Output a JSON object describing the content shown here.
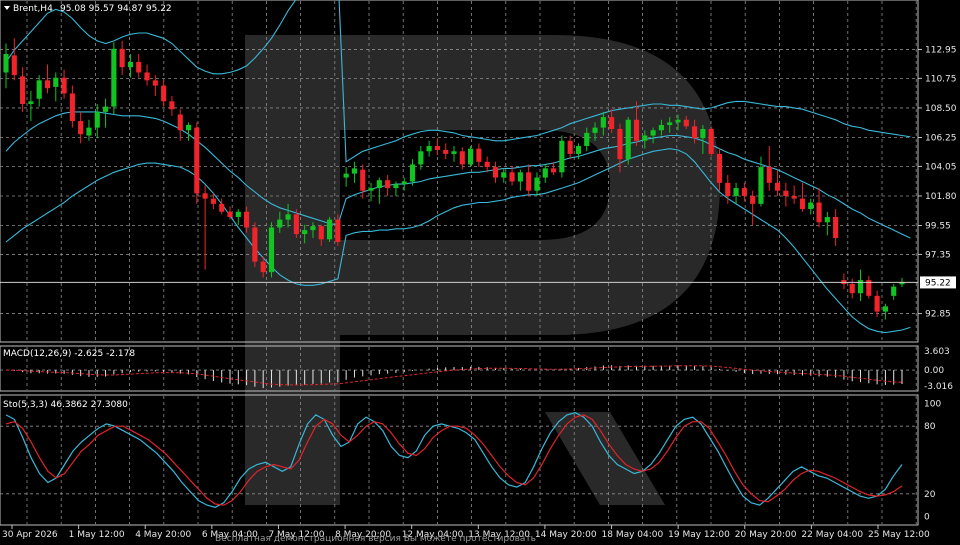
{
  "chart_data": {
    "type": "candlestick",
    "header": {
      "symbol": "Brent,H4",
      "ohlc": "95.08 95.57 94.87 95.22"
    },
    "price_axis": {
      "range": [
        91.6,
        115.8
      ],
      "ticks": [
        "112.95",
        "110.75",
        "108.50",
        "106.25",
        "104.05",
        "101.80",
        "99.55",
        "97.35",
        "95.22",
        "92.85"
      ],
      "tick_values": [
        112.95,
        110.75,
        108.5,
        106.25,
        104.05,
        101.8,
        99.55,
        97.35,
        92.85
      ],
      "current_price": 95.22
    },
    "time_axis": {
      "labels": [
        "30 Apr 2026",
        "1 May 12:00",
        "4 May 20:00",
        "6 May 04:00",
        "7 May 12:00",
        "8 May 20:00",
        "12 May 04:00",
        "13 May 12:00",
        "14 May 20:00",
        "18 May 04:00",
        "19 May 12:00",
        "20 May 20:00",
        "22 May 04:00",
        "25 May 12:00"
      ]
    },
    "candles": [
      {
        "o": 111.2,
        "h": 113.4,
        "l": 110.0,
        "c": 112.6
      },
      {
        "o": 112.5,
        "h": 113.8,
        "l": 110.6,
        "c": 111.0
      },
      {
        "o": 110.9,
        "h": 111.6,
        "l": 108.2,
        "c": 108.8
      },
      {
        "o": 108.8,
        "h": 109.8,
        "l": 107.5,
        "c": 109.0
      },
      {
        "o": 109.2,
        "h": 111.0,
        "l": 108.6,
        "c": 110.6
      },
      {
        "o": 110.6,
        "h": 111.8,
        "l": 109.6,
        "c": 110.0
      },
      {
        "o": 110.1,
        "h": 111.2,
        "l": 109.0,
        "c": 110.8
      },
      {
        "o": 110.8,
        "h": 111.4,
        "l": 109.2,
        "c": 109.6
      },
      {
        "o": 109.6,
        "h": 110.2,
        "l": 107.0,
        "c": 107.5
      },
      {
        "o": 107.5,
        "h": 108.2,
        "l": 105.8,
        "c": 106.5
      },
      {
        "o": 106.4,
        "h": 107.6,
        "l": 106.0,
        "c": 107.0
      },
      {
        "o": 107.0,
        "h": 108.8,
        "l": 106.2,
        "c": 108.2
      },
      {
        "o": 108.2,
        "h": 109.2,
        "l": 107.0,
        "c": 108.6
      },
      {
        "o": 108.6,
        "h": 113.5,
        "l": 108.0,
        "c": 113.0
      },
      {
        "o": 113.0,
        "h": 113.6,
        "l": 111.0,
        "c": 111.6
      },
      {
        "o": 111.6,
        "h": 112.6,
        "l": 110.8,
        "c": 112.0
      },
      {
        "o": 112.0,
        "h": 112.6,
        "l": 110.8,
        "c": 111.2
      },
      {
        "o": 111.2,
        "h": 111.8,
        "l": 110.2,
        "c": 110.6
      },
      {
        "o": 110.6,
        "h": 111.0,
        "l": 109.4,
        "c": 110.2
      },
      {
        "o": 110.2,
        "h": 110.6,
        "l": 108.6,
        "c": 109.0
      },
      {
        "o": 109.0,
        "h": 109.4,
        "l": 107.9,
        "c": 108.4
      },
      {
        "o": 108.0,
        "h": 108.4,
        "l": 106.0,
        "c": 106.8
      },
      {
        "o": 106.8,
        "h": 107.4,
        "l": 106.0,
        "c": 107.2
      },
      {
        "o": 107.0,
        "h": 107.4,
        "l": 101.2,
        "c": 102.0
      },
      {
        "o": 102.0,
        "h": 102.6,
        "l": 96.2,
        "c": 101.6
      },
      {
        "o": 101.6,
        "h": 102.0,
        "l": 100.8,
        "c": 101.2
      },
      {
        "o": 101.2,
        "h": 101.6,
        "l": 100.4,
        "c": 100.6
      },
      {
        "o": 100.6,
        "h": 101.0,
        "l": 100.0,
        "c": 100.2
      },
      {
        "o": 100.2,
        "h": 100.8,
        "l": 99.6,
        "c": 100.6
      },
      {
        "o": 100.6,
        "h": 101.0,
        "l": 99.0,
        "c": 99.4
      },
      {
        "o": 99.4,
        "h": 99.8,
        "l": 96.4,
        "c": 96.8
      },
      {
        "o": 96.8,
        "h": 97.2,
        "l": 95.6,
        "c": 96.0
      },
      {
        "o": 96.0,
        "h": 99.8,
        "l": 95.6,
        "c": 99.4
      },
      {
        "o": 99.4,
        "h": 100.6,
        "l": 99.0,
        "c": 100.0
      },
      {
        "o": 100.0,
        "h": 101.2,
        "l": 99.4,
        "c": 100.4
      },
      {
        "o": 100.4,
        "h": 100.8,
        "l": 98.6,
        "c": 98.9
      },
      {
        "o": 98.9,
        "h": 99.6,
        "l": 98.2,
        "c": 99.2
      },
      {
        "o": 99.2,
        "h": 99.8,
        "l": 98.6,
        "c": 99.5
      },
      {
        "o": 99.5,
        "h": 99.6,
        "l": 98.0,
        "c": 98.5
      },
      {
        "o": 98.5,
        "h": 100.2,
        "l": 98.3,
        "c": 100.0
      },
      {
        "o": 100.0,
        "h": 100.4,
        "l": 98.0,
        "c": 98.3
      },
      {
        "o": 103.2,
        "h": 104.0,
        "l": 102.5,
        "c": 103.5
      },
      {
        "o": 103.5,
        "h": 104.4,
        "l": 102.8,
        "c": 103.9
      },
      {
        "o": 103.8,
        "h": 104.2,
        "l": 101.6,
        "c": 102.2
      },
      {
        "o": 102.2,
        "h": 102.8,
        "l": 101.4,
        "c": 102.4
      },
      {
        "o": 102.4,
        "h": 103.2,
        "l": 101.2,
        "c": 103.0
      },
      {
        "o": 103.0,
        "h": 103.4,
        "l": 101.8,
        "c": 102.4
      },
      {
        "o": 102.4,
        "h": 102.9,
        "l": 101.8,
        "c": 102.7
      },
      {
        "o": 102.7,
        "h": 103.2,
        "l": 102.2,
        "c": 102.9
      },
      {
        "o": 102.9,
        "h": 104.6,
        "l": 102.6,
        "c": 104.2
      },
      {
        "o": 104.2,
        "h": 105.6,
        "l": 103.8,
        "c": 105.2
      },
      {
        "o": 105.2,
        "h": 106.0,
        "l": 104.8,
        "c": 105.6
      },
      {
        "o": 105.6,
        "h": 106.2,
        "l": 104.9,
        "c": 105.3
      },
      {
        "o": 105.3,
        "h": 105.8,
        "l": 104.6,
        "c": 105.0
      },
      {
        "o": 105.0,
        "h": 105.6,
        "l": 104.4,
        "c": 105.2
      },
      {
        "o": 105.2,
        "h": 105.5,
        "l": 103.8,
        "c": 104.2
      },
      {
        "o": 104.2,
        "h": 105.6,
        "l": 104.0,
        "c": 105.4
      },
      {
        "o": 105.4,
        "h": 105.8,
        "l": 104.0,
        "c": 104.4
      },
      {
        "o": 104.4,
        "h": 104.8,
        "l": 103.6,
        "c": 104.0
      },
      {
        "o": 104.0,
        "h": 104.4,
        "l": 102.8,
        "c": 103.2
      },
      {
        "o": 103.2,
        "h": 103.9,
        "l": 102.8,
        "c": 103.6
      },
      {
        "o": 103.6,
        "h": 104.1,
        "l": 102.6,
        "c": 102.9
      },
      {
        "o": 102.9,
        "h": 103.8,
        "l": 102.2,
        "c": 103.6
      },
      {
        "o": 103.6,
        "h": 104.2,
        "l": 101.8,
        "c": 102.2
      },
      {
        "o": 102.2,
        "h": 103.6,
        "l": 101.8,
        "c": 103.2
      },
      {
        "o": 103.2,
        "h": 104.2,
        "l": 102.8,
        "c": 103.9
      },
      {
        "o": 103.9,
        "h": 104.4,
        "l": 103.4,
        "c": 103.6
      },
      {
        "o": 103.6,
        "h": 106.4,
        "l": 103.2,
        "c": 106.0
      },
      {
        "o": 106.0,
        "h": 106.4,
        "l": 104.6,
        "c": 105.0
      },
      {
        "o": 105.0,
        "h": 105.8,
        "l": 104.6,
        "c": 105.6
      },
      {
        "o": 105.6,
        "h": 107.0,
        "l": 105.2,
        "c": 106.6
      },
      {
        "o": 106.6,
        "h": 107.4,
        "l": 106.0,
        "c": 107.0
      },
      {
        "o": 107.0,
        "h": 108.2,
        "l": 106.4,
        "c": 107.8
      },
      {
        "o": 107.8,
        "h": 108.4,
        "l": 106.6,
        "c": 106.9
      },
      {
        "o": 106.9,
        "h": 107.3,
        "l": 103.6,
        "c": 104.6
      },
      {
        "o": 104.6,
        "h": 107.8,
        "l": 104.2,
        "c": 107.6
      },
      {
        "o": 107.6,
        "h": 109.0,
        "l": 105.6,
        "c": 106.0
      },
      {
        "o": 106.0,
        "h": 106.8,
        "l": 105.4,
        "c": 106.4
      },
      {
        "o": 106.4,
        "h": 107.0,
        "l": 105.8,
        "c": 106.8
      },
      {
        "o": 106.8,
        "h": 107.6,
        "l": 106.4,
        "c": 107.2
      },
      {
        "o": 107.2,
        "h": 107.8,
        "l": 106.6,
        "c": 107.4
      },
      {
        "o": 107.4,
        "h": 108.0,
        "l": 106.8,
        "c": 107.6
      },
      {
        "o": 107.6,
        "h": 107.9,
        "l": 106.9,
        "c": 107.1
      },
      {
        "o": 107.1,
        "h": 107.6,
        "l": 105.8,
        "c": 106.2
      },
      {
        "o": 106.2,
        "h": 107.2,
        "l": 105.0,
        "c": 106.9
      },
      {
        "o": 106.9,
        "h": 107.0,
        "l": 104.8,
        "c": 105.0
      },
      {
        "o": 105.0,
        "h": 105.4,
        "l": 102.2,
        "c": 102.8
      },
      {
        "o": 102.8,
        "h": 103.4,
        "l": 101.2,
        "c": 101.8
      },
      {
        "o": 101.8,
        "h": 102.8,
        "l": 101.2,
        "c": 102.4
      },
      {
        "o": 102.4,
        "h": 102.8,
        "l": 101.4,
        "c": 101.8
      },
      {
        "o": 101.8,
        "h": 102.2,
        "l": 99.6,
        "c": 101.2
      },
      {
        "o": 101.2,
        "h": 104.8,
        "l": 101.0,
        "c": 104.0
      },
      {
        "o": 104.0,
        "h": 105.6,
        "l": 102.2,
        "c": 102.8
      },
      {
        "o": 102.8,
        "h": 103.8,
        "l": 101.8,
        "c": 102.2
      },
      {
        "o": 102.2,
        "h": 102.8,
        "l": 101.0,
        "c": 101.8
      },
      {
        "o": 101.8,
        "h": 102.6,
        "l": 101.2,
        "c": 101.6
      },
      {
        "o": 101.6,
        "h": 102.8,
        "l": 100.6,
        "c": 100.8
      },
      {
        "o": 100.8,
        "h": 101.6,
        "l": 100.4,
        "c": 101.3
      },
      {
        "o": 101.3,
        "h": 102.4,
        "l": 99.4,
        "c": 99.8
      },
      {
        "o": 99.8,
        "h": 100.6,
        "l": 98.8,
        "c": 100.2
      },
      {
        "o": 100.2,
        "h": 100.8,
        "l": 98.0,
        "c": 98.6
      },
      {
        "o": 95.4,
        "h": 95.9,
        "l": 94.7,
        "c": 95.1
      },
      {
        "o": 95.1,
        "h": 95.5,
        "l": 94.0,
        "c": 94.4
      },
      {
        "o": 94.4,
        "h": 96.2,
        "l": 93.8,
        "c": 95.4
      },
      {
        "o": 95.4,
        "h": 95.7,
        "l": 94.0,
        "c": 94.2
      },
      {
        "o": 94.2,
        "h": 94.6,
        "l": 92.6,
        "c": 93.0
      },
      {
        "o": 93.0,
        "h": 93.6,
        "l": 92.4,
        "c": 93.4
      },
      {
        "o": 94.2,
        "h": 95.1,
        "l": 93.9,
        "c": 94.9
      },
      {
        "o": 95.08,
        "h": 95.57,
        "l": 94.87,
        "c": 95.22
      }
    ],
    "bollinger": {
      "upper": [
        112.0,
        112.9,
        113.6,
        114.3,
        115.0,
        115.7,
        116.0,
        115.8,
        115.3,
        114.6,
        114.0,
        113.6,
        113.4,
        113.6,
        113.9,
        114.1,
        114.2,
        114.2,
        114.0,
        113.8,
        113.4,
        112.8,
        112.2,
        111.6,
        111.3,
        111.1,
        111.1,
        111.2,
        111.4,
        111.7,
        112.3,
        113.0,
        113.8,
        114.8,
        115.9,
        116.8,
        117.6,
        118.2,
        118.6,
        118.8,
        118.8,
        104.4,
        104.8,
        105.2,
        105.4,
        105.6,
        105.8,
        106.0,
        106.3,
        106.5,
        106.7,
        106.8,
        106.8,
        106.7,
        106.6,
        106.4,
        106.3,
        106.2,
        106.1,
        106.0,
        106.0,
        106.1,
        106.2,
        106.3,
        106.4,
        106.6,
        106.8,
        107.0,
        107.3,
        107.5,
        107.7,
        107.9,
        108.1,
        108.3,
        108.4,
        108.5,
        108.6,
        108.7,
        108.8,
        108.8,
        108.7,
        108.7,
        108.6,
        108.5,
        108.4,
        108.5,
        108.7,
        108.9,
        109.0,
        109.0,
        108.9,
        108.8,
        108.7,
        108.6,
        108.6,
        108.5,
        108.4,
        108.2,
        108.0,
        107.8,
        107.6,
        107.3,
        107.1,
        107.0,
        106.8,
        106.7,
        106.6,
        106.5,
        106.4,
        106.3
      ],
      "middle": [
        105.2,
        105.9,
        106.4,
        106.9,
        107.3,
        107.6,
        107.9,
        108.1,
        108.2,
        108.2,
        108.2,
        108.2,
        108.1,
        108.0,
        107.9,
        107.9,
        107.9,
        107.8,
        107.7,
        107.5,
        107.2,
        106.9,
        106.5,
        106.0,
        105.5,
        104.9,
        104.3,
        103.7,
        103.2,
        102.6,
        102.1,
        101.6,
        101.2,
        100.9,
        100.7,
        100.5,
        100.3,
        100.1,
        99.9,
        99.7,
        99.6,
        101.6,
        101.9,
        102.1,
        102.3,
        102.5,
        102.6,
        102.7,
        102.7,
        102.8,
        102.9,
        103.1,
        103.2,
        103.3,
        103.4,
        103.5,
        103.6,
        103.6,
        103.7,
        103.8,
        103.9,
        103.9,
        104.0,
        104.1,
        104.1,
        104.2,
        104.3,
        104.5,
        104.7,
        104.8,
        105.0,
        105.2,
        105.4,
        105.5,
        105.6,
        105.8,
        105.9,
        106.1,
        106.2,
        106.3,
        106.4,
        106.4,
        106.3,
        106.2,
        106.0,
        105.7,
        105.4,
        105.1,
        104.9,
        104.6,
        104.4,
        104.2,
        104.0,
        103.8,
        103.5,
        103.2,
        102.9,
        102.6,
        102.3,
        101.9,
        101.6,
        101.2,
        100.8,
        100.5,
        100.1,
        99.8,
        99.5,
        99.2,
        98.9,
        98.6
      ],
      "lower": [
        98.3,
        98.8,
        99.3,
        99.7,
        100.1,
        100.5,
        100.9,
        101.3,
        101.8,
        102.2,
        102.6,
        103.0,
        103.3,
        103.6,
        103.8,
        104.0,
        104.2,
        104.3,
        104.3,
        104.2,
        104.1,
        104.0,
        103.7,
        103.3,
        102.7,
        102.0,
        101.2,
        100.3,
        99.4,
        98.6,
        97.8,
        97.1,
        96.4,
        95.8,
        95.4,
        95.1,
        95.0,
        95.0,
        95.1,
        95.3,
        95.5,
        98.8,
        99.0,
        99.1,
        99.1,
        99.2,
        99.2,
        99.3,
        99.3,
        99.4,
        99.6,
        99.9,
        100.3,
        100.6,
        100.9,
        101.1,
        101.2,
        101.3,
        101.3,
        101.4,
        101.5,
        101.7,
        101.8,
        101.9,
        101.9,
        102.0,
        102.2,
        102.4,
        102.6,
        102.8,
        103.1,
        103.4,
        103.7,
        104.0,
        104.3,
        104.6,
        104.8,
        105.0,
        105.2,
        105.3,
        105.4,
        105.3,
        105.0,
        104.4,
        103.6,
        102.8,
        102.1,
        101.6,
        101.2,
        100.8,
        100.4,
        100.0,
        99.6,
        99.2,
        98.6,
        97.9,
        97.1,
        96.3,
        95.5,
        94.7,
        94.0,
        93.3,
        92.6,
        92.1,
        91.7,
        91.5,
        91.4,
        91.5,
        91.6,
        91.8
      ]
    },
    "macd": {
      "label": "MACD(12,26,9) -2.625 -2.178",
      "range": [
        -3.4,
        4.0
      ],
      "ticks": [
        "3.603",
        "0.00",
        "-3.016"
      ],
      "tick_values": [
        3.603,
        0,
        -3.016
      ]
    },
    "stochastic": {
      "label": "Sto(5,3,3) 46.3862 27.3080",
      "range": [
        -5,
        105
      ],
      "ticks": [
        "100",
        "80",
        "20",
        "0"
      ],
      "tick_values": [
        100,
        80,
        20,
        0
      ],
      "main": [
        90,
        86,
        70,
        52,
        38,
        30,
        34,
        46,
        58,
        66,
        72,
        78,
        82,
        80,
        76,
        72,
        68,
        62,
        56,
        48,
        40,
        30,
        22,
        14,
        10,
        8,
        12,
        22,
        34,
        42,
        46,
        48,
        44,
        40,
        44,
        64,
        82,
        90,
        86,
        72,
        62,
        66,
        82,
        88,
        84,
        76,
        62,
        54,
        52,
        58,
        72,
        80,
        82,
        80,
        78,
        74,
        68,
        56,
        44,
        34,
        28,
        26,
        30,
        44,
        60,
        74,
        84,
        90,
        92,
        88,
        80,
        66,
        54,
        46,
        42,
        38,
        40,
        46,
        56,
        68,
        80,
        86,
        88,
        82,
        70,
        58,
        44,
        30,
        18,
        12,
        10,
        16,
        24,
        32,
        40,
        44,
        40,
        36,
        34,
        30,
        26,
        22,
        18,
        16,
        18,
        24,
        36,
        46
      ],
      "signal": [
        82,
        84,
        78,
        66,
        52,
        40,
        34,
        38,
        48,
        58,
        64,
        72,
        76,
        80,
        80,
        76,
        72,
        68,
        62,
        56,
        48,
        40,
        32,
        24,
        16,
        11,
        10,
        14,
        22,
        32,
        40,
        44,
        46,
        44,
        42,
        50,
        66,
        80,
        86,
        82,
        72,
        66,
        72,
        80,
        84,
        82,
        74,
        64,
        56,
        54,
        60,
        70,
        76,
        80,
        80,
        78,
        72,
        64,
        54,
        44,
        36,
        30,
        28,
        34,
        46,
        60,
        72,
        82,
        88,
        90,
        86,
        76,
        64,
        54,
        46,
        42,
        40,
        42,
        48,
        58,
        70,
        80,
        84,
        84,
        78,
        66,
        54,
        40,
        28,
        20,
        14,
        13,
        18,
        24,
        32,
        38,
        41,
        40,
        37,
        34,
        30,
        26,
        22,
        19,
        18,
        19,
        22,
        27
      ]
    }
  },
  "watermark": {
    "text": "Бесплатная демонстрационная версия  Вы можете протестировать"
  }
}
